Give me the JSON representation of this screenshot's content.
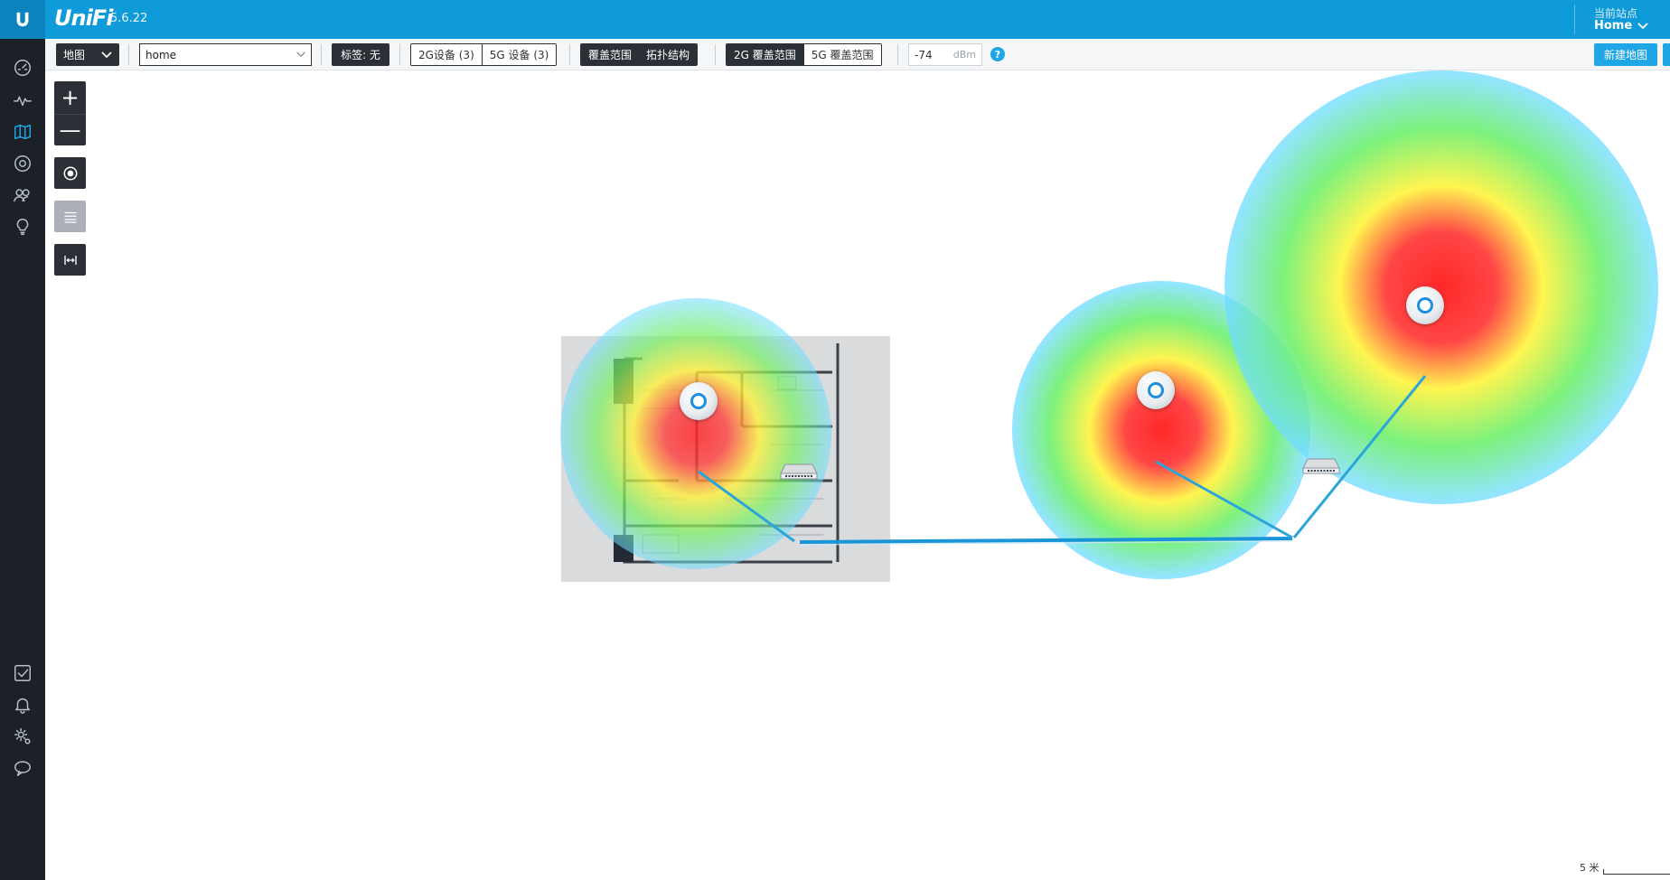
{
  "header": {
    "brand": "UniFi",
    "version": "5.6.22",
    "site_label": "当前站点",
    "site_value": "Home"
  },
  "toolbar": {
    "view_select": "地图",
    "map_name": "home",
    "tag_label": "标签: 无",
    "device_tabs": [
      "2G设备 (3)",
      "5G 设备 (3)"
    ],
    "view_tabs": [
      "覆盖范围",
      "拓扑结构"
    ],
    "band_tabs": [
      "2G 覆盖范围",
      "5G 覆盖范围"
    ],
    "dbm_value": "-74",
    "dbm_unit": "dBm",
    "help": "?",
    "new_map": "新建地图"
  },
  "map": {
    "zoom_in": "+",
    "zoom_out": "—",
    "scale_label": "5 米",
    "access_points": [
      "ap-1",
      "ap-2",
      "ap-3"
    ],
    "switches": [
      "switch-1",
      "switch-2"
    ]
  },
  "icons": [
    "unifi-logo-icon",
    "dashboard-icon",
    "statistics-icon",
    "map-icon",
    "devices-icon",
    "clients-icon",
    "insights-icon",
    "events-icon",
    "alerts-icon",
    "settings-icon",
    "chat-icon"
  ],
  "colors": {
    "topbar": "#0f9ad9",
    "sidebar": "#1b2127",
    "accent": "#1fa6e6",
    "dark_button": "#2a3036"
  }
}
